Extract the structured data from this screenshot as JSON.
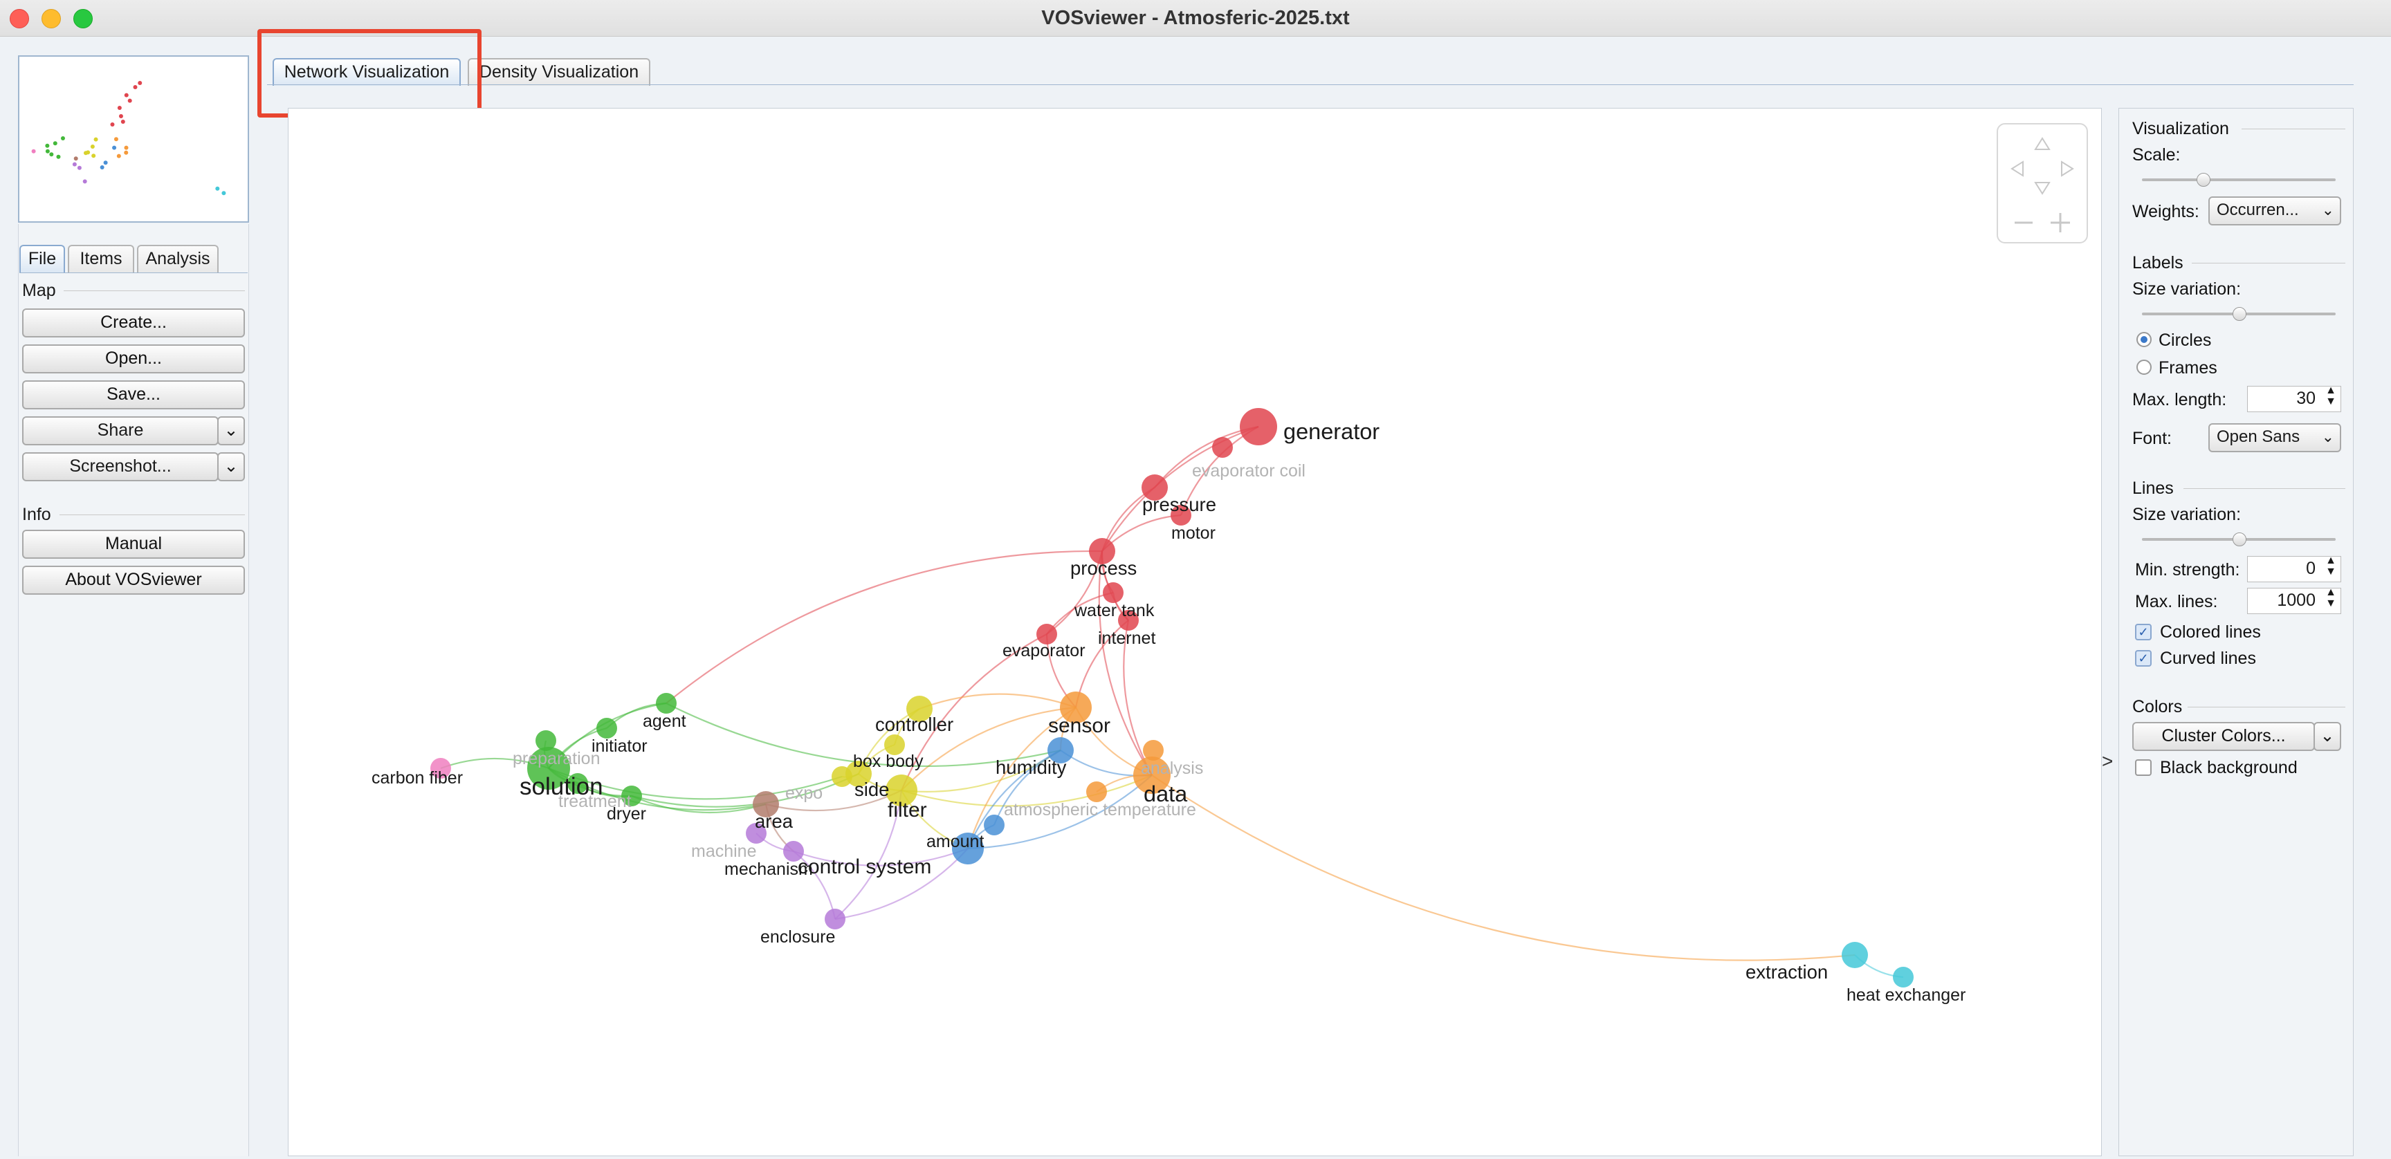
{
  "window": {
    "title": "VOSviewer - Atmosferic-2025.txt"
  },
  "main_tabs": [
    {
      "label": "Network Visualization",
      "active": true
    },
    {
      "label": "Density Visualization",
      "active": false
    }
  ],
  "left_tabs": [
    "File",
    "Items",
    "Analysis"
  ],
  "map_section": {
    "title": "Map",
    "buttons": [
      "Create...",
      "Open...",
      "Save...",
      "Share",
      "Screenshot..."
    ]
  },
  "info_section": {
    "title": "Info",
    "buttons": [
      "Manual",
      "About VOSviewer"
    ]
  },
  "visualization_panel": {
    "title": "Visualization",
    "scale_label": "Scale:",
    "scale_value": 0.3,
    "weights_label": "Weights:",
    "weights_value": "Occurren..."
  },
  "labels_panel": {
    "title": "Labels",
    "size_variation_label": "Size variation:",
    "size_variation_value": 0.5,
    "circles_label": "Circles",
    "frames_label": "Frames",
    "selected": "Circles",
    "max_length_label": "Max. length:",
    "max_length_value": "30",
    "font_label": "Font:",
    "font_value": "Open Sans"
  },
  "lines_panel": {
    "title": "Lines",
    "size_variation_label": "Size variation:",
    "size_variation_value": 0.5,
    "min_strength_label": "Min. strength:",
    "min_strength_value": "0",
    "max_lines_label": "Max. lines:",
    "max_lines_value": "1000",
    "colored_lines_label": "Colored lines",
    "colored_lines": true,
    "curved_lines_label": "Curved lines",
    "curved_lines": true
  },
  "colors_panel": {
    "title": "Colors",
    "cluster_colors_label": "Cluster Colors...",
    "black_background_label": "Black background",
    "black_background": false
  },
  "collapse_arrow": ">",
  "cluster_colors": {
    "red": "#e0454f",
    "green": "#43b83a",
    "blue": "#4a90d6",
    "yellow": "#d9d22c",
    "purple": "#b57ad8",
    "cyan": "#44c8d8",
    "orange": "#f59a3b",
    "brown": "#b27c6c",
    "pink": "#f07fc0"
  },
  "network": {
    "nodes": [
      {
        "label": "generator",
        "cluster": "red",
        "weight": 5
      },
      {
        "label": "evaporator coil",
        "cluster": "red",
        "weight": 2,
        "faded": true
      },
      {
        "label": "pressure",
        "cluster": "red",
        "weight": 3
      },
      {
        "label": "motor",
        "cluster": "red",
        "weight": 2
      },
      {
        "label": "process",
        "cluster": "red",
        "weight": 3
      },
      {
        "label": "water tank",
        "cluster": "red",
        "weight": 2
      },
      {
        "label": "internet",
        "cluster": "red",
        "weight": 2
      },
      {
        "label": "evaporator",
        "cluster": "red",
        "weight": 2
      },
      {
        "label": "agent",
        "cluster": "green",
        "weight": 2
      },
      {
        "label": "initiator",
        "cluster": "green",
        "weight": 2
      },
      {
        "label": "preparation",
        "cluster": "green",
        "weight": 2,
        "faded": true
      },
      {
        "label": "solution",
        "cluster": "green",
        "weight": 6
      },
      {
        "label": "carbon fiber",
        "cluster": "pink",
        "weight": 2
      },
      {
        "label": "treatment",
        "cluster": "green",
        "weight": 2,
        "faded": true
      },
      {
        "label": "dryer",
        "cluster": "green",
        "weight": 2
      },
      {
        "label": "controller",
        "cluster": "yellow",
        "weight": 3
      },
      {
        "label": "box body",
        "cluster": "yellow",
        "weight": 2
      },
      {
        "label": "expo",
        "cluster": "yellow",
        "weight": 2,
        "faded": true
      },
      {
        "label": "side",
        "cluster": "yellow",
        "weight": 3
      },
      {
        "label": "filter",
        "cluster": "yellow",
        "weight": 4
      },
      {
        "label": "area",
        "cluster": "brown",
        "weight": 3
      },
      {
        "label": "machine",
        "cluster": "purple",
        "weight": 2,
        "faded": true
      },
      {
        "label": "mechanism",
        "cluster": "purple",
        "weight": 2
      },
      {
        "label": "enclosure",
        "cluster": "purple",
        "weight": 2
      },
      {
        "label": "sensor",
        "cluster": "orange",
        "weight": 4
      },
      {
        "label": "humidity",
        "cluster": "blue",
        "weight": 3
      },
      {
        "label": "analysis",
        "cluster": "orange",
        "weight": 2,
        "faded": true
      },
      {
        "label": "data",
        "cluster": "orange",
        "weight": 5
      },
      {
        "label": "atmospheric temperature",
        "cluster": "orange",
        "weight": 2,
        "faded": true
      },
      {
        "label": "amount",
        "cluster": "blue",
        "weight": 2
      },
      {
        "label": "control system",
        "cluster": "blue",
        "weight": 4
      },
      {
        "label": "extraction",
        "cluster": "cyan",
        "weight": 3
      },
      {
        "label": "heat exchanger",
        "cluster": "cyan",
        "weight": 2
      }
    ],
    "links": [
      [
        "generator",
        "pressure"
      ],
      [
        "generator",
        "motor"
      ],
      [
        "generator",
        "process"
      ],
      [
        "pressure",
        "process"
      ],
      [
        "motor",
        "process"
      ],
      [
        "process",
        "water tank"
      ],
      [
        "process",
        "internet"
      ],
      [
        "water tank",
        "internet"
      ],
      [
        "water tank",
        "evaporator"
      ],
      [
        "internet",
        "sensor"
      ],
      [
        "internet",
        "data"
      ],
      [
        "process",
        "data"
      ],
      [
        "process",
        "agent"
      ],
      [
        "evaporator",
        "sensor"
      ],
      [
        "evaporator",
        "filter"
      ],
      [
        "sensor",
        "data"
      ],
      [
        "sensor",
        "humidity"
      ],
      [
        "sensor",
        "controller"
      ],
      [
        "sensor",
        "filter"
      ],
      [
        "controller",
        "side"
      ],
      [
        "controller",
        "box body"
      ],
      [
        "box body",
        "side"
      ],
      [
        "side",
        "filter"
      ],
      [
        "filter",
        "humidity"
      ],
      [
        "filter",
        "control system"
      ],
      [
        "filter",
        "data"
      ],
      [
        "humidity",
        "data"
      ],
      [
        "humidity",
        "control system"
      ],
      [
        "humidity",
        "amount"
      ],
      [
        "amount",
        "control system"
      ],
      [
        "data",
        "atmospheric temperature"
      ],
      [
        "data",
        "extraction"
      ],
      [
        "extraction",
        "heat exchanger"
      ],
      [
        "agent",
        "solution"
      ],
      [
        "agent",
        "initiator"
      ],
      [
        "agent",
        "humidity"
      ],
      [
        "initiator",
        "solution"
      ],
      [
        "solution",
        "carbon fiber"
      ],
      [
        "solution",
        "treatment"
      ],
      [
        "solution",
        "dryer"
      ],
      [
        "solution",
        "area"
      ],
      [
        "treatment",
        "dryer"
      ],
      [
        "dryer",
        "area"
      ],
      [
        "dryer",
        "side"
      ],
      [
        "area",
        "filter"
      ],
      [
        "area",
        "mechanism"
      ],
      [
        "mechanism",
        "control system"
      ],
      [
        "machine",
        "mechanism"
      ],
      [
        "enclosure",
        "control system"
      ],
      [
        "enclosure",
        "mechanism"
      ],
      [
        "enclosure",
        "filter"
      ],
      [
        "solution",
        "expo"
      ],
      [
        "expo",
        "side"
      ],
      [
        "control system",
        "data"
      ],
      [
        "sensor",
        "control system"
      ],
      [
        "evaporator",
        "process"
      ],
      [
        "preparation",
        "solution"
      ]
    ]
  }
}
